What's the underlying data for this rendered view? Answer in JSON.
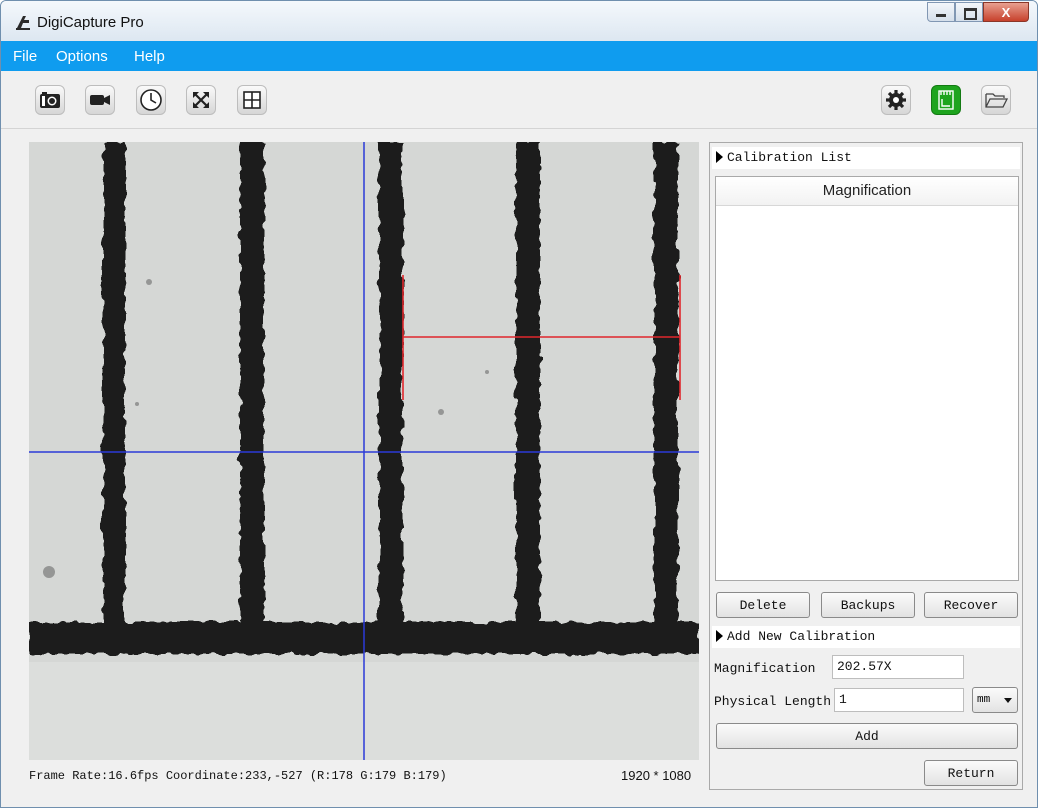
{
  "window": {
    "title": "DigiCapture Pro",
    "close_glyph": "X"
  },
  "menu": [
    "File",
    "Options",
    "Help"
  ],
  "toolbar": {
    "left_icons": [
      "camera-icon",
      "video-icon",
      "timer-icon",
      "fullscreen-icon",
      "grid-icon"
    ],
    "right_icons": [
      "settings-icon",
      "sd-card-icon",
      "folder-icon"
    ]
  },
  "colors": {
    "menubar": "#0f9cef",
    "crosshair": "#2b3ad8",
    "measure": "#e0262c",
    "accent_green": "#1ea41e"
  },
  "panel": {
    "calibration_list_title": "Calibration List",
    "table_header": "Magnification",
    "delete_label": "Delete",
    "backups_label": "Backups",
    "recover_label": "Recover",
    "add_new_title": "Add New Calibration",
    "magnification_label": "Magnification",
    "magnification_value": "202.57X",
    "physical_length_label": "Physical Length",
    "physical_length_value": "1",
    "unit_value": "mm",
    "add_label": "Add",
    "return_label": "Return"
  },
  "status": {
    "info": "Frame Rate:16.6fps Coordinate:233,-527 (R:178 G:179 B:179)",
    "resolution": "1920 * 1080"
  }
}
